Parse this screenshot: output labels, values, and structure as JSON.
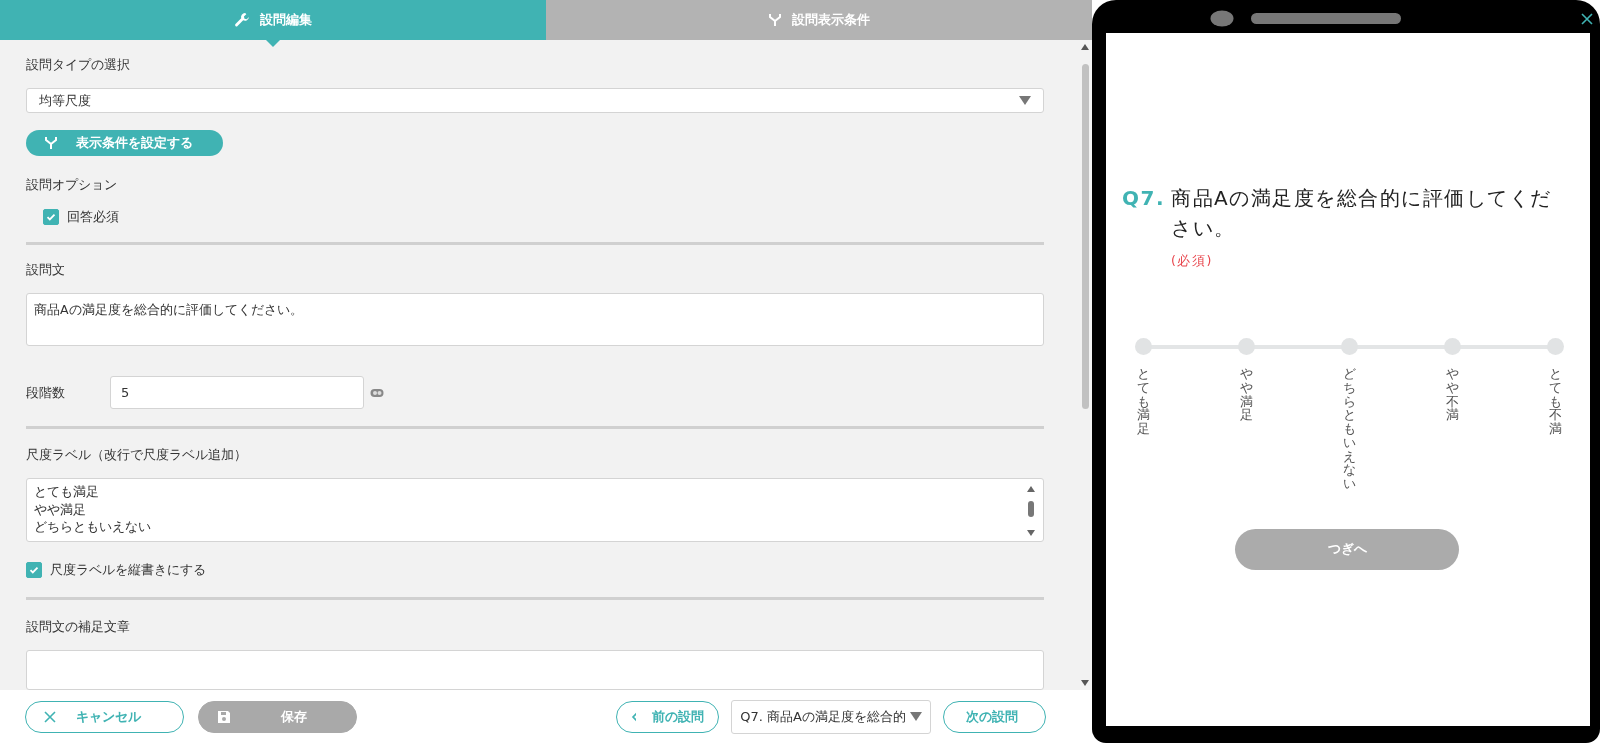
{
  "tabs": [
    {
      "label": "設問編集",
      "selected": true
    },
    {
      "label": "設問表示条件",
      "selected": false
    }
  ],
  "form": {
    "type_label": "設問タイプの選択",
    "type_value": "均等尺度",
    "condition_button": "表示条件を設定する",
    "options_label": "設問オプション",
    "options": [
      {
        "label": "回答必須",
        "checked": true
      }
    ],
    "question_label": "設問文",
    "question_text": "商品Aの満足度を総合的に評価してください。",
    "steps_label": "段階数",
    "steps_value": "5",
    "scale_label": "尺度ラベル（改行で尺度ラベル追加）",
    "scale_lines": [
      "とても満足",
      "やや満足",
      "どちらともいえない"
    ],
    "vertical": {
      "label": "尺度ラベルを縦書きにする",
      "checked": true
    },
    "supplement_label": "設問文の補足文章"
  },
  "footer": {
    "cancel": "キャンセル",
    "save": "保存",
    "save_disabled": true,
    "prev": "前の設問",
    "question_select": "Q7. 商品Aの満足度を総合的",
    "next": "次の設問"
  },
  "preview": {
    "number": "Q7.",
    "question": "商品Aの満足度を総合的に評価してください。",
    "required": "(必須)",
    "scale": [
      {
        "label": "とても満足",
        "selected": false
      },
      {
        "label": "やや満足",
        "selected": false
      },
      {
        "label": "どちらともいえない",
        "selected": false
      },
      {
        "label": "やや不満",
        "selected": false
      },
      {
        "label": "とても不満",
        "selected": false
      }
    ],
    "next_button": "つぎへ",
    "next_disabled": true
  }
}
